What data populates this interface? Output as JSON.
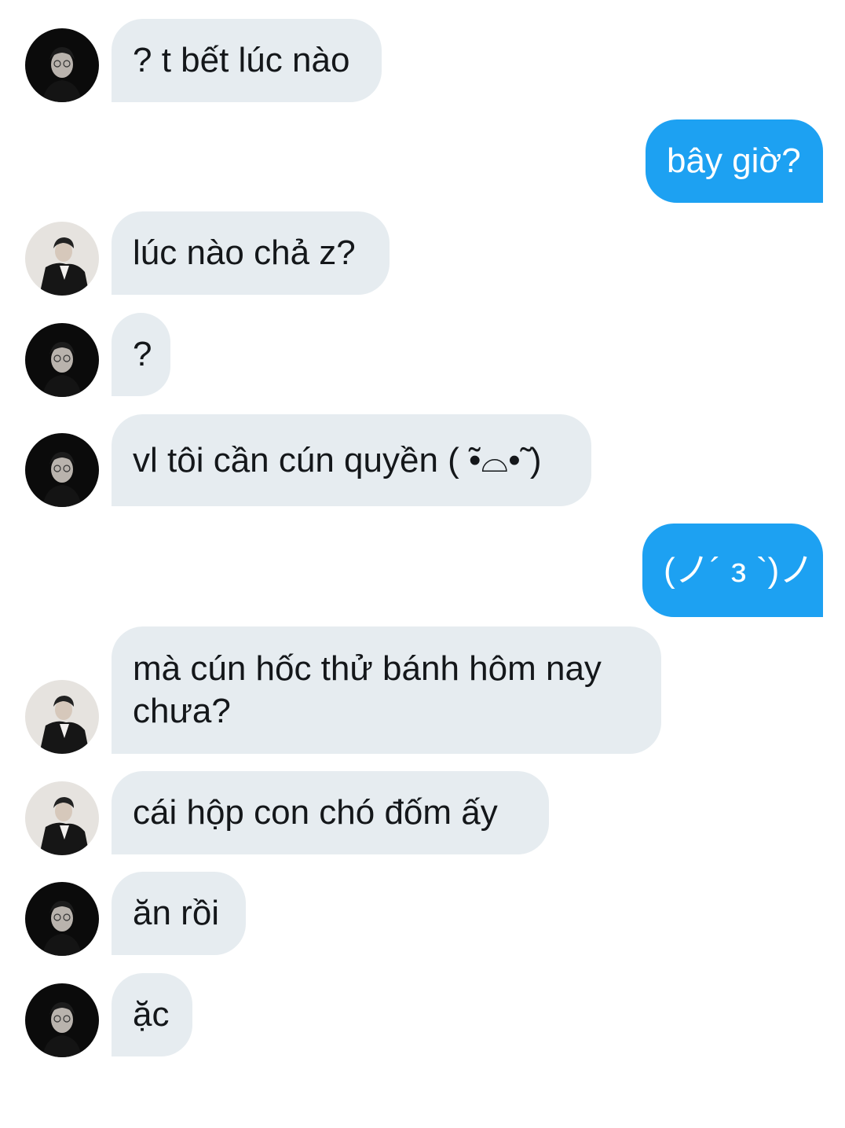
{
  "messages": [
    {
      "side": "in",
      "avatar": "dark-avatar",
      "text": "? t bết lúc nào"
    },
    {
      "side": "out",
      "text": "bây giờ?"
    },
    {
      "side": "in",
      "avatar": "light-avatar",
      "text": "lúc nào chả z?"
    },
    {
      "side": "in",
      "avatar": "dark-avatar",
      "text": "?"
    },
    {
      "side": "in",
      "avatar": "dark-avatar",
      "text": "vl tôi cần cún quyền ( ̃•⌓•̃ )"
    },
    {
      "side": "out",
      "text": "(ノ´ з `)ノ"
    },
    {
      "side": "in",
      "avatar": "light-avatar",
      "text": "mà cún hốc thử bánh hôm nay chưa?"
    },
    {
      "side": "in",
      "avatar": "light-avatar",
      "text": "cái hộp con chó đốm ấy"
    },
    {
      "side": "in",
      "avatar": "dark-avatar",
      "text": "ăn rồi"
    },
    {
      "side": "in",
      "avatar": "dark-avatar",
      "text": "ặc"
    }
  ],
  "colors": {
    "incoming_bubble": "#e6ecf0",
    "outgoing_bubble": "#1da1f2",
    "text_dark": "#14171a",
    "text_light": "#ffffff"
  }
}
